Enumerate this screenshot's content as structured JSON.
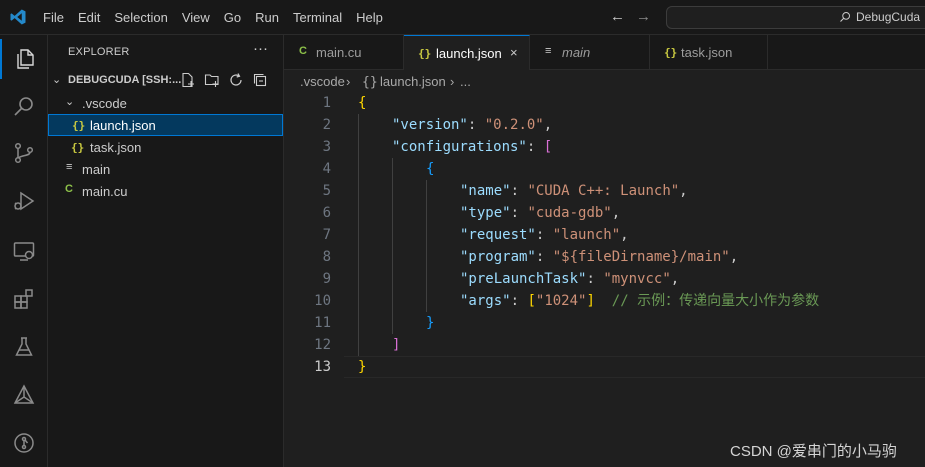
{
  "titlebar": {
    "menu": [
      "File",
      "Edit",
      "Selection",
      "View",
      "Go",
      "Run",
      "Terminal",
      "Help"
    ],
    "nav_back": "←",
    "nav_forward": "→",
    "command_center": "DebugCuda"
  },
  "sidebar": {
    "title": "EXPLORER",
    "more": "···",
    "root": "DEBUGCUDA [SSH:...",
    "tree": [
      {
        "label": ".vscode",
        "type": "folder"
      },
      {
        "label": "launch.json",
        "type": "json",
        "selected": true
      },
      {
        "label": "task.json",
        "type": "json"
      },
      {
        "label": "main",
        "type": "file"
      },
      {
        "label": "main.cu",
        "type": "cu"
      }
    ]
  },
  "tabs": [
    {
      "label": "main.cu",
      "icon": "cuda-icon"
    },
    {
      "label": "launch.json",
      "icon": "json-icon",
      "active": true,
      "close": "×"
    },
    {
      "label": "main",
      "icon": "file-icon"
    },
    {
      "label": "task.json",
      "icon": "json-icon"
    }
  ],
  "breadcrumb": {
    "folder": ".vscode",
    "file": "launch.json",
    "more": "..."
  },
  "editor": {
    "line_numbers": [
      "1",
      "2",
      "3",
      "4",
      "5",
      "6",
      "7",
      "8",
      "9",
      "10",
      "11",
      "12",
      "13"
    ],
    "lines": [
      "{",
      "\"version\": \"0.2.0\",",
      "\"configurations\": [",
      "{",
      "\"name\": \"CUDA C++: Launch\",",
      "\"type\": \"cuda-gdb\",",
      "\"request\": \"launch\",",
      "\"program\": \"${fileDirname}/main\",",
      "\"preLaunchTask\": \"mynvcc\",",
      "\"args\": [\"1024\"]  // 示例：传递向量大小作为参数",
      "}",
      "]",
      "}"
    ],
    "current_line": 13
  },
  "watermark": "CSDN @爱串门的小马驹",
  "colors": {
    "accent": "#0078d4",
    "key": "#9cdcfe",
    "string": "#ce9178",
    "comment": "#6a9955"
  }
}
